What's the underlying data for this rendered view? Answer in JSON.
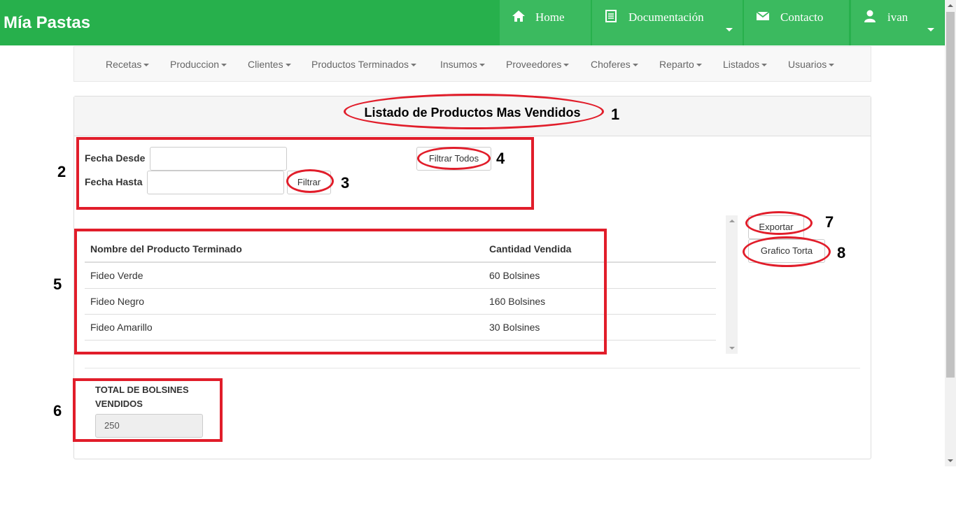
{
  "brand": "Mía Pastas",
  "topnav": {
    "home": "Home",
    "docs": "Documentación",
    "contact": "Contacto",
    "user": "ivan"
  },
  "subnav": [
    "Recetas",
    "Produccion",
    "Clientes",
    "Productos Terminados",
    "Insumos",
    "Proveedores",
    "Choferes",
    "Reparto",
    "Listados",
    "Usuarios"
  ],
  "panel": {
    "title": "Listado de Productos Mas Vendidos"
  },
  "filters": {
    "desde_label": "Fecha Desde",
    "hasta_label": "Fecha Hasta",
    "desde_value": "",
    "hasta_value": "",
    "filtrar": "Filtrar",
    "filtrar_todos": "Filtrar Todos"
  },
  "table": {
    "headers": [
      "Nombre del Producto Terminado",
      "Cantidad Vendida"
    ],
    "rows": [
      [
        "Fideo Verde",
        "60 Bolsines"
      ],
      [
        "Fideo Negro",
        "160 Bolsines"
      ],
      [
        "Fideo Amarillo",
        "30 Bolsines"
      ]
    ]
  },
  "actions": {
    "exportar": "Exportar",
    "grafico": "Grafico Torta"
  },
  "total": {
    "label": "TOTAL DE BOLSINES VENDIDOS",
    "value": "250"
  },
  "annotations": [
    "1",
    "2",
    "3",
    "4",
    "5",
    "6",
    "7",
    "8"
  ],
  "colors": {
    "navbar": "#27b04c",
    "navbar_item": "#3bba5f",
    "annotation": "#e11d2a"
  },
  "icons": {
    "home": "home-icon",
    "docs": "list-icon",
    "contact": "envelope-icon",
    "user": "user-icon"
  }
}
